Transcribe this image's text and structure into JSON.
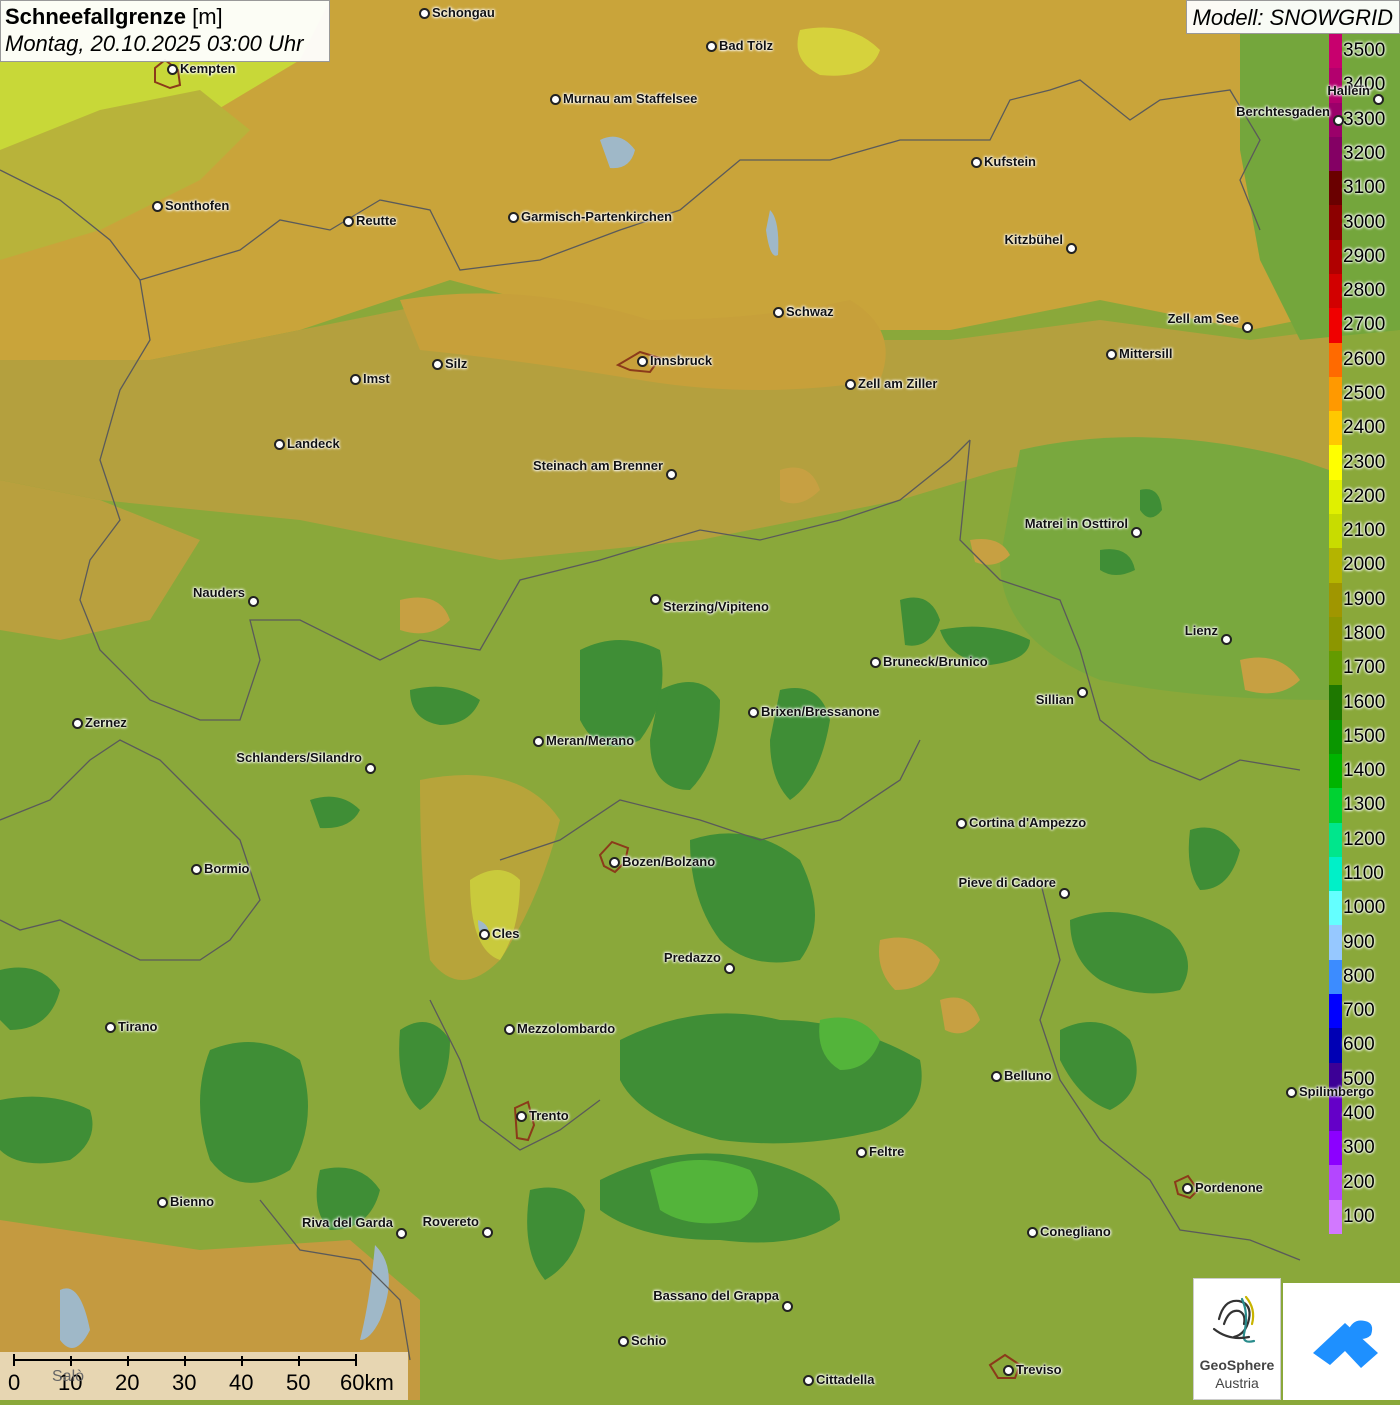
{
  "header": {
    "title_bold": "Schneefallgrenze",
    "title_unit": "[m]",
    "datetime": "Montag, 20.10.2025 03:00 Uhr",
    "model": "Modell: SNOWGRID"
  },
  "legend": {
    "labels": [
      "3500",
      "3400",
      "3300",
      "3200",
      "3100",
      "3000",
      "2900",
      "2800",
      "2700",
      "2600",
      "2500",
      "2400",
      "2300",
      "2200",
      "2100",
      "2000",
      "1900",
      "1800",
      "1700",
      "1600",
      "1500",
      "1400",
      "1300",
      "1200",
      "1100",
      "1000",
      "900",
      "800",
      "700",
      "600",
      "500",
      "400",
      "300",
      "200",
      "100"
    ],
    "colors": [
      "#c8006e",
      "#b3006e",
      "#9b006a",
      "#840064",
      "#6a0000",
      "#8c0000",
      "#b00000",
      "#d20000",
      "#f00000",
      "#ff6a00",
      "#ff9900",
      "#ffc800",
      "#ffff00",
      "#e0f000",
      "#c8dc00",
      "#b4b400",
      "#a09600",
      "#8c9600",
      "#649b00",
      "#1e7800",
      "#0a9600",
      "#00b400",
      "#00d232",
      "#00e68c",
      "#00f0c8",
      "#64ffff",
      "#96c8ff",
      "#3c8cff",
      "#0000ff",
      "#0000b4",
      "#3c0096",
      "#6400c8",
      "#8c00ff",
      "#b446ff",
      "#d278ff"
    ]
  },
  "cities": [
    {
      "name": "Schongau"
    },
    {
      "name": "Bad Tölz"
    },
    {
      "name": "Kempten"
    },
    {
      "name": "Murnau am Staffelsee"
    },
    {
      "name": "Sonthofen"
    },
    {
      "name": "Reutte"
    },
    {
      "name": "Garmisch-Partenkirchen"
    },
    {
      "name": "Kufstein"
    },
    {
      "name": "Kitzbühel"
    },
    {
      "name": "Berchtesgaden"
    },
    {
      "name": "Hallein"
    },
    {
      "name": "Schwaz"
    },
    {
      "name": "Zell am See"
    },
    {
      "name": "Mittersill"
    },
    {
      "name": "Innsbruck"
    },
    {
      "name": "Imst"
    },
    {
      "name": "Silz"
    },
    {
      "name": "Zell am Ziller"
    },
    {
      "name": "Landeck"
    },
    {
      "name": "Steinach am Brenner"
    },
    {
      "name": "Matrei in Osttirol"
    },
    {
      "name": "Nauders"
    },
    {
      "name": "Sterzing/Vipiteno"
    },
    {
      "name": "Lienz"
    },
    {
      "name": "Bruneck/Brunico"
    },
    {
      "name": "Sillian"
    },
    {
      "name": "Zernez"
    },
    {
      "name": "Brixen/Bressanone"
    },
    {
      "name": "Meran/Merano"
    },
    {
      "name": "Schlanders/Silandro"
    },
    {
      "name": "Cortina d'Ampezzo"
    },
    {
      "name": "Bormio"
    },
    {
      "name": "Bozen/Bolzano"
    },
    {
      "name": "Pieve di Cadore"
    },
    {
      "name": "Cles"
    },
    {
      "name": "Predazzo"
    },
    {
      "name": "Tirano"
    },
    {
      "name": "Mezzolombardo"
    },
    {
      "name": "Belluno"
    },
    {
      "name": "Spilimbergo"
    },
    {
      "name": "Trento"
    },
    {
      "name": "Feltre"
    },
    {
      "name": "Pordenone"
    },
    {
      "name": "Bienno"
    },
    {
      "name": "Riva del Garda"
    },
    {
      "name": "Rovereto"
    },
    {
      "name": "Conegliano"
    },
    {
      "name": "Bassano del Grappa"
    },
    {
      "name": "Schio"
    },
    {
      "name": "Treviso"
    },
    {
      "name": "Cittadella"
    },
    {
      "name": "Salò"
    }
  ],
  "scale": {
    "labels": [
      "0",
      "10",
      "20",
      "30",
      "40",
      "50",
      "60km"
    ]
  },
  "logos": {
    "geosphere_line1": "GeoSphere",
    "geosphere_line2": "Austria"
  }
}
